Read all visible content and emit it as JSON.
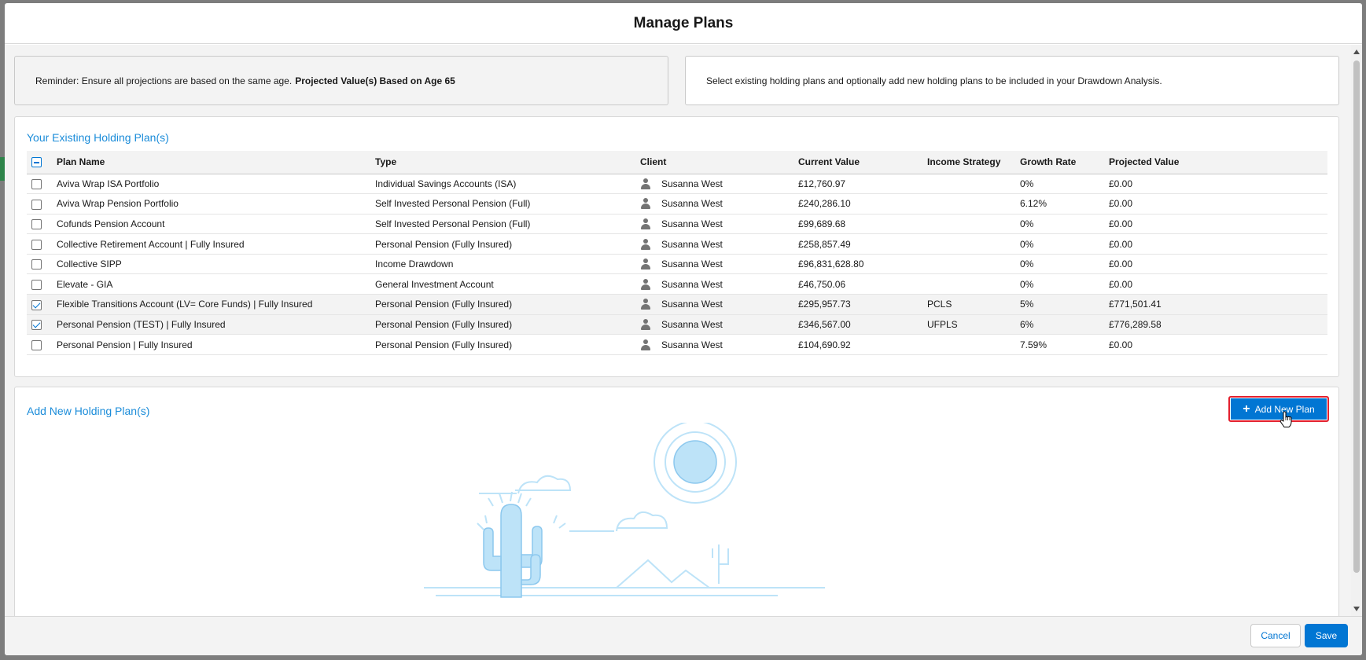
{
  "modal": {
    "title": "Manage Plans"
  },
  "info": {
    "reminder_text": "Reminder: Ensure all projections are based on the same age.",
    "reminder_bold": "Projected Value(s) Based on Age 65",
    "instructions": "Select existing holding plans and optionally add new holding plans to be included in your Drawdown Analysis."
  },
  "existing": {
    "title": "Your Existing Holding Plan(s)",
    "columns": [
      "Plan Name",
      "Type",
      "Client",
      "Current Value",
      "Income Strategy",
      "Growth Rate",
      "Projected Value"
    ],
    "rows": [
      {
        "checked": false,
        "plan": "Aviva Wrap ISA Portfolio",
        "type": "Individual Savings Accounts (ISA)",
        "client": "Susanna West",
        "current": "£12,760.97",
        "strategy": "",
        "growth": "0%",
        "projected": "£0.00"
      },
      {
        "checked": false,
        "plan": "Aviva Wrap Pension Portfolio",
        "type": "Self Invested Personal Pension (Full)",
        "client": "Susanna West",
        "current": "£240,286.10",
        "strategy": "",
        "growth": "6.12%",
        "projected": "£0.00"
      },
      {
        "checked": false,
        "plan": "Cofunds Pension Account",
        "type": "Self Invested Personal Pension (Full)",
        "client": "Susanna West",
        "current": "£99,689.68",
        "strategy": "",
        "growth": "0%",
        "projected": "£0.00"
      },
      {
        "checked": false,
        "plan": "Collective Retirement Account | Fully Insured",
        "type": "Personal Pension (Fully Insured)",
        "client": "Susanna West",
        "current": "£258,857.49",
        "strategy": "",
        "growth": "0%",
        "projected": "£0.00"
      },
      {
        "checked": false,
        "plan": "Collective SIPP",
        "type": "Income Drawdown",
        "client": "Susanna West",
        "current": "£96,831,628.80",
        "strategy": "",
        "growth": "0%",
        "projected": "£0.00"
      },
      {
        "checked": false,
        "plan": "Elevate - GIA",
        "type": "General Investment Account",
        "client": "Susanna West",
        "current": "£46,750.06",
        "strategy": "",
        "growth": "0%",
        "projected": "£0.00"
      },
      {
        "checked": true,
        "plan": "Flexible Transitions Account (LV= Core Funds) | Fully Insured",
        "type": "Personal Pension (Fully Insured)",
        "client": "Susanna West",
        "current": "£295,957.73",
        "strategy": "PCLS",
        "growth": "5%",
        "projected": "£771,501.41"
      },
      {
        "checked": true,
        "plan": "Personal Pension (TEST) | Fully Insured",
        "type": "Personal Pension (Fully Insured)",
        "client": "Susanna West",
        "current": "£346,567.00",
        "strategy": "UFPLS",
        "growth": "6%",
        "projected": "£776,289.58"
      },
      {
        "checked": false,
        "plan": "Personal Pension | Fully Insured",
        "type": "Personal Pension (Fully Insured)",
        "client": "Susanna West",
        "current": "£104,690.92",
        "strategy": "",
        "growth": "7.59%",
        "projected": "£0.00"
      }
    ]
  },
  "new_plans": {
    "title": "Add New Holding Plan(s)",
    "add_label": "Add New Plan"
  },
  "footer": {
    "cancel_label": "Cancel",
    "save_label": "Save"
  },
  "colors": {
    "brand": "#0176d3",
    "title_blue": "#1b8cd9",
    "focus_ring": "#e3202e",
    "illustration": "#bde3f8"
  }
}
